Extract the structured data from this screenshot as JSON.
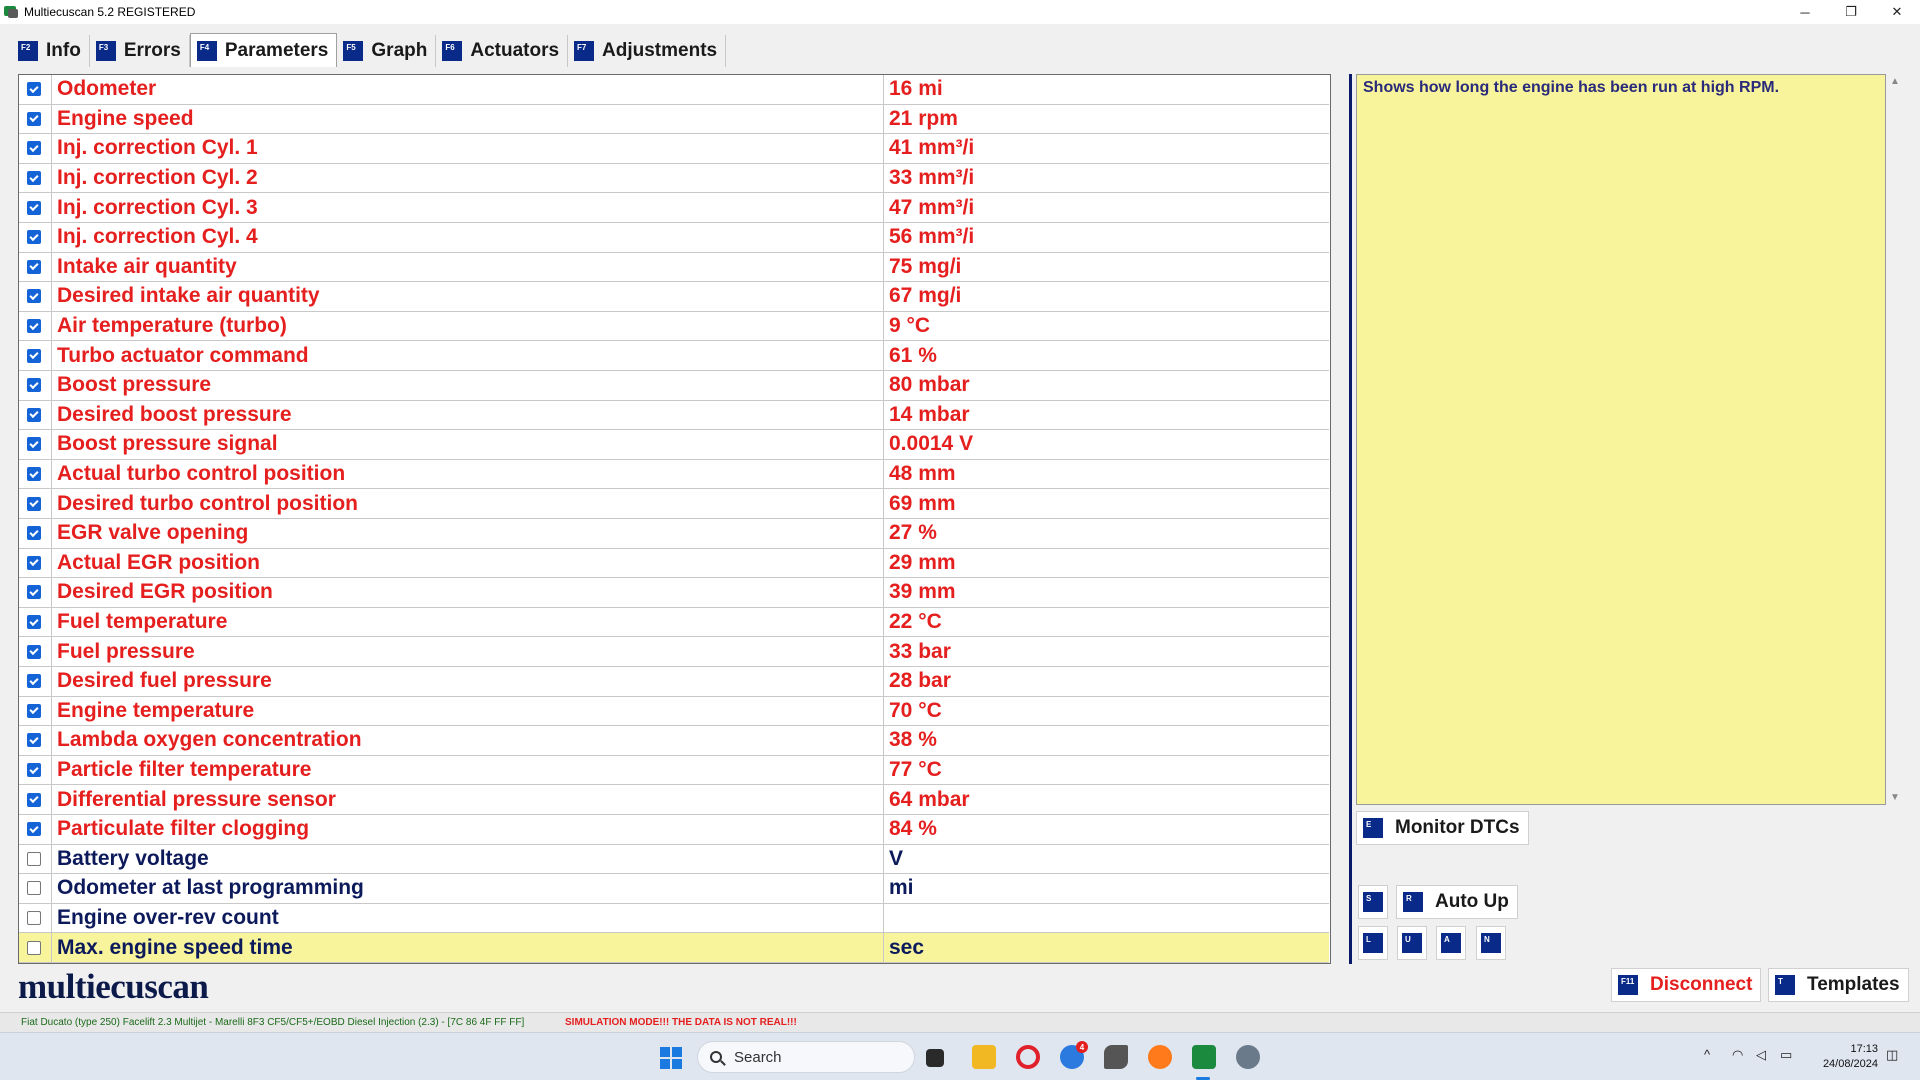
{
  "window": {
    "title": "Multiecuscan 5.2 REGISTERED",
    "minimize": "─",
    "restore": "❐",
    "close": "✕"
  },
  "tabs": [
    {
      "key": "F2",
      "label": "Info"
    },
    {
      "key": "F3",
      "label": "Errors"
    },
    {
      "key": "F4",
      "label": "Parameters"
    },
    {
      "key": "F5",
      "label": "Graph"
    },
    {
      "key": "F6",
      "label": "Actuators"
    },
    {
      "key": "F7",
      "label": "Adjustments"
    }
  ],
  "parameters": [
    {
      "name": "Odometer",
      "value": "16 mi",
      "checked": true
    },
    {
      "name": "Engine speed",
      "value": "21 rpm",
      "checked": true
    },
    {
      "name": "Inj. correction Cyl. 1",
      "value": "41 mm³/i",
      "checked": true
    },
    {
      "name": "Inj. correction Cyl. 2",
      "value": "33 mm³/i",
      "checked": true
    },
    {
      "name": "Inj. correction Cyl. 3",
      "value": "47 mm³/i",
      "checked": true
    },
    {
      "name": "Inj. correction Cyl. 4",
      "value": "56 mm³/i",
      "checked": true
    },
    {
      "name": "Intake air quantity",
      "value": "75 mg/i",
      "checked": true
    },
    {
      "name": "Desired intake air quantity",
      "value": "67 mg/i",
      "checked": true
    },
    {
      "name": "Air temperature (turbo)",
      "value": "9 °C",
      "checked": true
    },
    {
      "name": "Turbo actuator command",
      "value": "61 %",
      "checked": true
    },
    {
      "name": "Boost pressure",
      "value": "80 mbar",
      "checked": true
    },
    {
      "name": "Desired boost pressure",
      "value": "14 mbar",
      "checked": true
    },
    {
      "name": "Boost pressure signal",
      "value": "0.0014 V",
      "checked": true
    },
    {
      "name": "Actual turbo control position",
      "value": "48 mm",
      "checked": true
    },
    {
      "name": "Desired turbo control position",
      "value": "69 mm",
      "checked": true
    },
    {
      "name": "EGR valve opening",
      "value": "27 %",
      "checked": true
    },
    {
      "name": "Actual EGR position",
      "value": "29 mm",
      "checked": true
    },
    {
      "name": "Desired EGR position",
      "value": "39 mm",
      "checked": true
    },
    {
      "name": "Fuel temperature",
      "value": "22 °C",
      "checked": true
    },
    {
      "name": "Fuel pressure",
      "value": "33 bar",
      "checked": true
    },
    {
      "name": "Desired fuel pressure",
      "value": "28 bar",
      "checked": true
    },
    {
      "name": "Engine temperature",
      "value": "70 °C",
      "checked": true
    },
    {
      "name": "Lambda oxygen concentration",
      "value": "38 %",
      "checked": true
    },
    {
      "name": "Particle filter temperature",
      "value": "77 °C",
      "checked": true
    },
    {
      "name": "Differential pressure sensor",
      "value": "64 mbar",
      "checked": true
    },
    {
      "name": "Particulate filter clogging",
      "value": "84 %",
      "checked": true
    },
    {
      "name": "Battery voltage",
      "value": "V",
      "checked": false
    },
    {
      "name": "Odometer at last programming",
      "value": "mi",
      "checked": false
    },
    {
      "name": "Engine over-rev count",
      "value": "",
      "checked": false
    },
    {
      "name": "Max. engine speed time",
      "value": "sec",
      "checked": false,
      "selected": true
    }
  ],
  "description": "Shows how long the engine has been run at high RPM.",
  "buttons": {
    "monitor_dtcs": {
      "key": "E",
      "label": "Monitor DTCs"
    },
    "s": {
      "key": "S"
    },
    "auto_up": {
      "key": "R",
      "label": "Auto Up"
    },
    "l": {
      "key": "L"
    },
    "u": {
      "key": "U"
    },
    "a": {
      "key": "A"
    },
    "n": {
      "key": "N"
    },
    "disconnect": {
      "key": "F11",
      "label": "Disconnect"
    },
    "templates": {
      "key": "T",
      "label": "Templates"
    }
  },
  "logo": "multiecuscan",
  "status": {
    "vehicle": "Fiat Ducato (type 250) Facelift 2.3 Multijet - Marelli 8F3 CF5/CF5+/EOBD Diesel Injection (2.3) - [7C 86 4F FF FF]",
    "simulation": "SIMULATION MODE!!! THE DATA IS NOT REAL!!!"
  },
  "taskbar": {
    "search_placeholder": "Search",
    "badge": "4",
    "time": "17:13",
    "date": "24/08/2024"
  },
  "colors": {
    "active_param": "#e51e1e",
    "inactive_param": "#0c1a5c",
    "selected_row": "#f7f49c",
    "fkey_bg": "#0a2a8a"
  }
}
